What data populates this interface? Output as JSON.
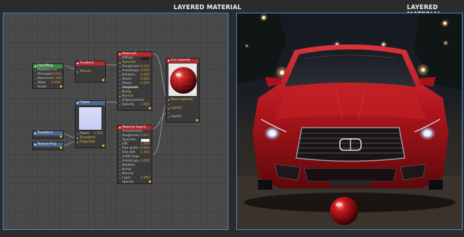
{
  "left_panel": {
    "title": "LAYERED MATERIAL"
  },
  "right_panel": {
    "title": "LAYERED MATERIAL"
  },
  "nodes": {
    "falloff": {
      "title": "FalloffMap",
      "rows": [
        {
          "label": "Mode",
          "value": "Normal vs"
        },
        {
          "label": "Minimum",
          "value": "0.000"
        },
        {
          "label": "Maximum",
          "value": "1.000"
        },
        {
          "label": "Skew factor",
          "value": "0.000"
        }
      ]
    },
    "gradient": {
      "title": "Gradient",
      "texture_label": "Texture"
    },
    "material1": {
      "title": "Material1",
      "rows": [
        {
          "label": "Diffuse",
          "value": ""
        },
        {
          "label": "Specular",
          "value": ""
        },
        {
          "label": "Roughness",
          "value": "0.144"
        },
        {
          "label": "Anisotropy",
          "value": "0.000"
        },
        {
          "label": "Rotation",
          "value": "0.000"
        },
        {
          "label": "Sheen",
          "value": "0.000"
        },
        {
          "label": "Sheen roughness",
          "value": "0.000"
        },
        {
          "label": "Film width",
          "value": ""
        },
        {
          "label": "Bump",
          "value": ""
        },
        {
          "label": "Normal",
          "value": ""
        },
        {
          "label": "Displacement",
          "value": ""
        },
        {
          "label": "Opacity",
          "value": "1.000"
        }
      ]
    },
    "carlayered": {
      "title": "Car Layered",
      "rows": [
        {
          "label": "Base material",
          "value": ""
        },
        {
          "label": "Layer1",
          "value": ""
        },
        {
          "label": "Layer2",
          "value": ""
        }
      ]
    },
    "flakes": {
      "title": "Flakes",
      "rows": [
        {
          "label": "Power",
          "value": "1.000"
        },
        {
          "label": "Transform",
          "value": ""
        },
        {
          "label": "Projection",
          "value": ""
        }
      ]
    },
    "transform": {
      "title": "Transform"
    },
    "texproj": {
      "title": "Texture Proj."
    },
    "materiallayer2": {
      "title": "Material layer2",
      "rows": [
        {
          "label": "Transmission",
          "value": ""
        },
        {
          "label": "Roughness",
          "value": "0.027"
        },
        {
          "label": "Specular",
          "value": ""
        },
        {
          "label": "IOR",
          "value": "1.600"
        },
        {
          "label": "Film width",
          "value": "0.000"
        },
        {
          "label": "Film IOR",
          "value": "1.450"
        },
        {
          "label": "1/IOR map",
          "value": ""
        },
        {
          "label": "Anisotropy",
          "value": "0.000"
        },
        {
          "label": "Rotation",
          "value": ""
        },
        {
          "label": "Bump",
          "value": ""
        },
        {
          "label": "Normal",
          "value": ""
        },
        {
          "label": "Layer opacity",
          "value": "1.000"
        }
      ]
    }
  },
  "colors": {
    "accent_border": "#4a8ad0",
    "car_paint": "#b0161c",
    "node_header_red": "#b8282c",
    "node_header_blue": "#4a6890",
    "node_header_green": "#3a8a40"
  }
}
